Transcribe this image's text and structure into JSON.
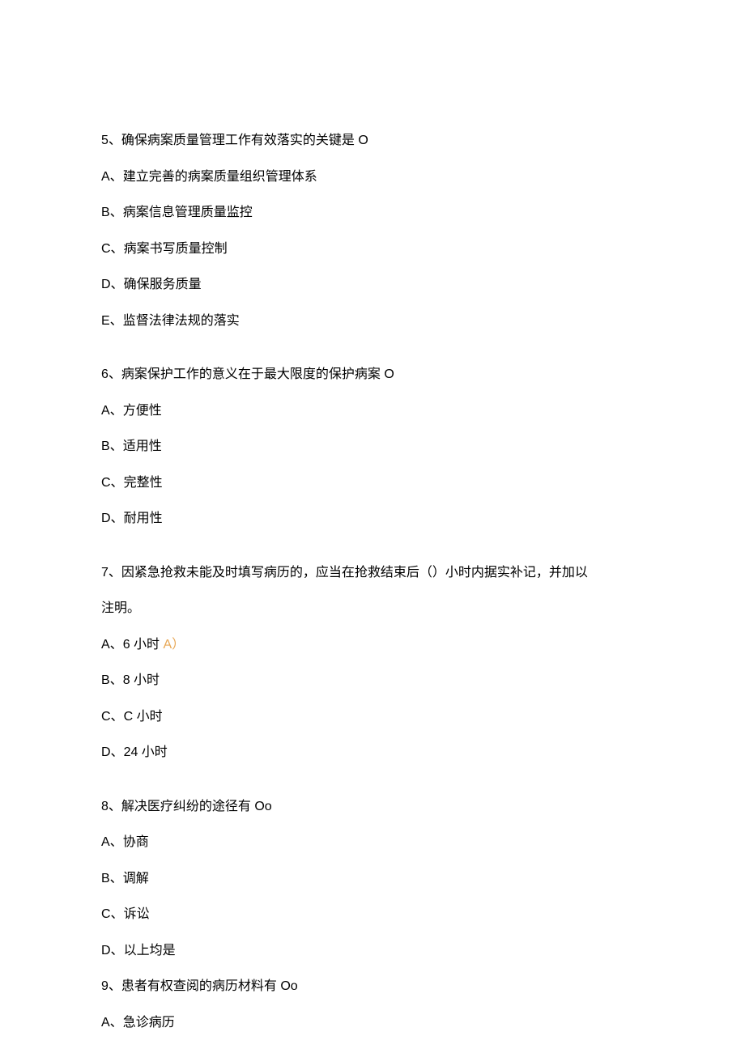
{
  "questions": [
    {
      "number": "5、",
      "stem": "确保病案质量管理工作有效落实的关键是 O",
      "options": [
        {
          "label": "A、",
          "text": "建立完善的病案质量组织管理体系"
        },
        {
          "label": "B、",
          "text": "病案信息管理质量监控"
        },
        {
          "label": "C、",
          "text": "病案书写质量控制"
        },
        {
          "label": "D、",
          "text": "确保服务质量"
        },
        {
          "label": "E、",
          "text": "监督法律法规的落实"
        }
      ]
    },
    {
      "number": "6、",
      "stem": "病案保护工作的意义在于最大限度的保护病案 O",
      "options": [
        {
          "label": "A、",
          "text": "方便性"
        },
        {
          "label": "B、",
          "text": "适用性"
        },
        {
          "label": "C、",
          "text": "完整性"
        },
        {
          "label": "D、",
          "text": "耐用性"
        }
      ]
    },
    {
      "number": "7、",
      "stem": "因紧急抢救未能及时填写病历的，应当在抢救结束后（）小时内据实补记，并加以",
      "stem_line2": "注明。",
      "options": [
        {
          "label": "A、",
          "text": "6 小时 ",
          "highlight": "A）"
        },
        {
          "label": "B、",
          "text": "8 小时"
        },
        {
          "label": "C、",
          "text": "C 小时"
        },
        {
          "label": "D、",
          "text": "24 小时"
        }
      ]
    },
    {
      "number": "8、",
      "stem": "解决医疗纠纷的途径有 Oo",
      "options": [
        {
          "label": "A、",
          "text": "协商"
        },
        {
          "label": "B、",
          "text": "调解"
        },
        {
          "label": "C、",
          "text": "诉讼"
        },
        {
          "label": "D、",
          "text": "以上均是"
        }
      ]
    },
    {
      "number": "9、",
      "stem": "患者有权查阅的病历材料有 Oo",
      "options": [
        {
          "label": "A、",
          "text": "急诊病历"
        }
      ]
    }
  ]
}
